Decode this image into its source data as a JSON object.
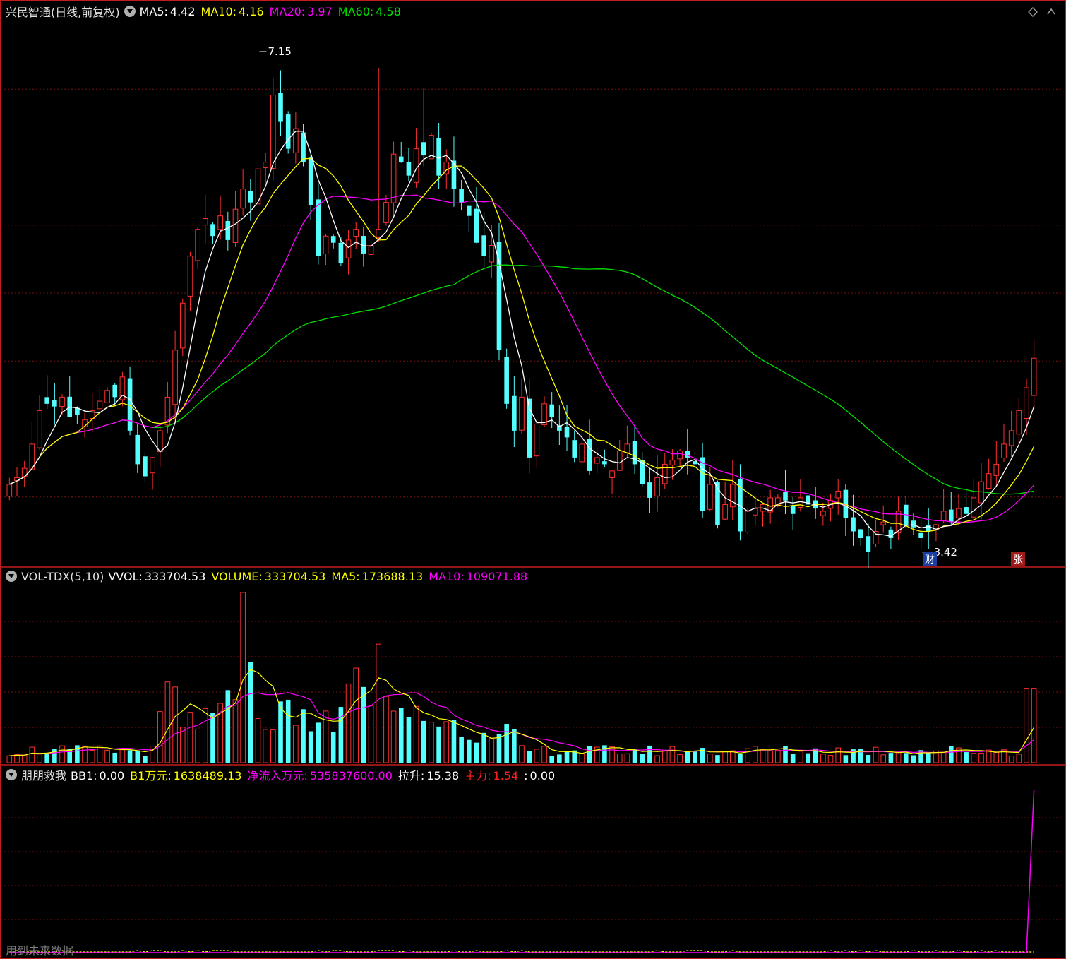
{
  "panel1": {
    "title": "兴民智通(日线,前复权)",
    "indicators": [
      {
        "label": "MA5:",
        "value": "4.42",
        "color": "#ffffff"
      },
      {
        "label": "MA10:",
        "value": "4.16",
        "color": "#ffff00"
      },
      {
        "label": "MA20:",
        "value": "3.97",
        "color": "#ff00ff"
      },
      {
        "label": "MA60:",
        "value": "4.58",
        "color": "#00e000"
      }
    ],
    "high_label": "7.15",
    "low_label": "3.42",
    "tag_cai": "财",
    "tag_zhang": "张"
  },
  "panel2": {
    "title": "VOL-TDX(5,10)",
    "indicators": [
      {
        "label": "VVOL:",
        "value": "333704.53",
        "color": "#ffffff"
      },
      {
        "label": "VOLUME:",
        "value": "333704.53",
        "color": "#ffff00"
      },
      {
        "label": "MA5:",
        "value": "173688.13",
        "color": "#ffff00"
      },
      {
        "label": "MA10:",
        "value": "109071.88",
        "color": "#ff00ff"
      }
    ]
  },
  "panel3": {
    "title": "朋朋救我",
    "indicators": [
      {
        "label": "BB1:",
        "value": "0.00",
        "color": "#ffffff"
      },
      {
        "label": "B1万元:",
        "value": "1638489.13",
        "color": "#ffff00"
      },
      {
        "label": "净流入万元:",
        "value": "535837600.00",
        "color": "#ff00ff"
      },
      {
        "label": "拉升:",
        "value": "15.38",
        "color": "#ffffff"
      },
      {
        "label": "主力:",
        "value": "1.54",
        "color": "#ff2020"
      },
      {
        "label": ":",
        "value": "0.00",
        "color": "#ffffff"
      }
    ],
    "footer": "用到未来数据"
  },
  "colors": {
    "up": "#ff3030",
    "down": "#54ffff",
    "ma5": "#ffffff",
    "ma10": "#ffff00",
    "ma20": "#ff00ff",
    "ma60": "#00e000",
    "grid": "#7a1010",
    "border": "#c21d1d"
  },
  "chart_data": [
    {
      "type": "candlestick",
      "price_range": [
        3.3,
        7.35
      ],
      "series": [
        {
          "name": "price",
          "close": [
            3.9,
            3.95,
            4.02,
            4.2,
            4.45,
            4.5,
            4.48,
            4.55,
            4.4,
            4.42,
            4.38,
            4.45,
            4.52,
            4.6,
            4.55,
            4.7,
            4.3,
            4.05,
            3.96,
            4.1,
            4.3,
            4.55,
            4.9,
            5.25,
            5.6,
            5.8,
            5.88,
            5.75,
            5.9,
            5.72,
            5.95,
            6.1,
            6.0,
            6.25,
            6.3,
            6.8,
            6.6,
            6.4,
            6.55,
            6.3,
            5.98,
            5.6,
            5.75,
            5.7,
            5.55,
            5.72,
            5.8,
            5.62,
            5.68,
            5.8,
            6.0,
            6.36,
            6.3,
            6.2,
            6.4,
            6.35,
            6.5,
            6.2,
            6.3,
            6.1,
            6.0,
            5.9,
            5.7,
            5.6,
            5.68,
            4.9,
            4.5,
            4.3,
            4.55,
            4.1,
            4.35,
            4.5,
            4.4,
            4.3,
            4.25,
            4.1,
            4.2,
            4.0,
            4.1,
            4.05,
            4.0,
            4.15,
            4.2,
            4.05,
            3.9,
            3.8,
            3.95,
            4.05,
            4.08,
            4.15,
            4.1,
            4.05,
            3.7,
            3.9,
            3.6,
            3.75,
            3.9,
            3.55,
            3.7,
            3.72,
            3.75,
            3.8,
            3.8,
            3.78,
            3.68,
            3.8,
            3.75,
            3.72,
            3.7,
            3.78,
            3.85,
            3.65,
            3.55,
            3.5,
            3.4,
            3.55,
            3.62,
            3.5,
            3.7,
            3.6,
            3.58,
            3.5,
            3.55,
            3.6,
            3.7,
            3.62,
            3.72,
            3.68,
            3.8,
            3.92,
            3.98,
            4.05,
            4.2,
            4.3,
            4.45,
            4.62,
            4.84
          ]
        },
        {
          "name": "MA5",
          "last": 4.42
        },
        {
          "name": "MA10",
          "last": 4.16
        },
        {
          "name": "MA20",
          "last": 3.97
        },
        {
          "name": "MA60",
          "last": 4.58
        }
      ],
      "annotations": [
        {
          "text": "7.15",
          "kind": "high"
        },
        {
          "text": "3.42",
          "kind": "low"
        }
      ]
    },
    {
      "type": "bar",
      "title": "VOL-TDX(5,10)",
      "series": [
        {
          "name": "VOLUME",
          "last": 333704.53
        },
        {
          "name": "MA5",
          "last": 173688.13
        },
        {
          "name": "MA10",
          "last": 109071.88
        }
      ]
    },
    {
      "type": "line",
      "title": "朋朋救我",
      "series": [
        {
          "name": "净流入万元",
          "last": 535837600.0
        },
        {
          "name": "主力",
          "last": 1.54
        },
        {
          "name": "拉升",
          "last": 15.38
        }
      ]
    }
  ]
}
